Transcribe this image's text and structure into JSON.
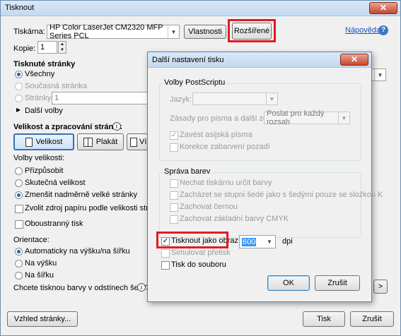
{
  "window": {
    "title": "Tisknout"
  },
  "printer": {
    "label": "Tiskárna:",
    "value": "HP Color LaserJet CM2320 MFP Series PCL",
    "properties_label": "Vlastnosti",
    "advanced_label": "Rozšířené",
    "help_label": "Nápověda"
  },
  "copies": {
    "label": "Kopie:",
    "value": "1"
  },
  "pages": {
    "heading": "Tisknuté stránky",
    "all": "Všechny",
    "current": "Současná stránka",
    "pages": "Stránky",
    "pages_value": "1",
    "more": "Další volby"
  },
  "sizing": {
    "heading": "Velikost a zpracování stránek",
    "size_btn": "Velikost",
    "poster_btn": "Plakát",
    "multi_btn_partial": "Ví",
    "options_label": "Volby velikosti:",
    "fit": "Přizpůsobit",
    "actual": "Skutečná velikost",
    "shrink": "Zmenšit nadměrně velké stránky",
    "paper_source": "Zvolit zdroj papíru podle velikosti stránky PDF",
    "duplex": "Oboustranný tisk"
  },
  "orientation": {
    "label": "Orientace:",
    "auto": "Automaticky na výšku/na šířku",
    "portrait": "Na výšku",
    "landscape": "Na šířku"
  },
  "grayscale_question": "Chcete tisknou barvy v odstínech šedí?",
  "footer": {
    "page_setup": "Vzhled stránky...",
    "print": "Tisk",
    "cancel": "Zrušit"
  },
  "dialog": {
    "title": "Další nastavení tisku",
    "postscript": {
      "group": "Volby PostScriptu",
      "language_label": "Jazyk:",
      "font_policy_label": "Zásady pro písma a další zdroje:",
      "font_policy_value": "Poslat pro každý rozsah",
      "asian_fonts": "Zavést asijská písma",
      "background_correction": "Korekce zabarvení pozadí"
    },
    "color": {
      "group": "Správa barev",
      "printer_determines": "Nechat tiskárnu určit barvy",
      "gray_as_k": "Zacházet se stupni šedé jako s šedými pouze se složkou K",
      "preserve_black": "Zachovat černou",
      "preserve_cmyk": "Zachovat základní barvy CMYK"
    },
    "print_as_image": "Tisknout jako obraz",
    "dpi_value": "600",
    "dpi_label": "dpi",
    "simulate_overprint": "Simulovat přetisk",
    "print_to_file": "Tisk do souboru",
    "ok": "OK",
    "cancel": "Zrušit"
  }
}
